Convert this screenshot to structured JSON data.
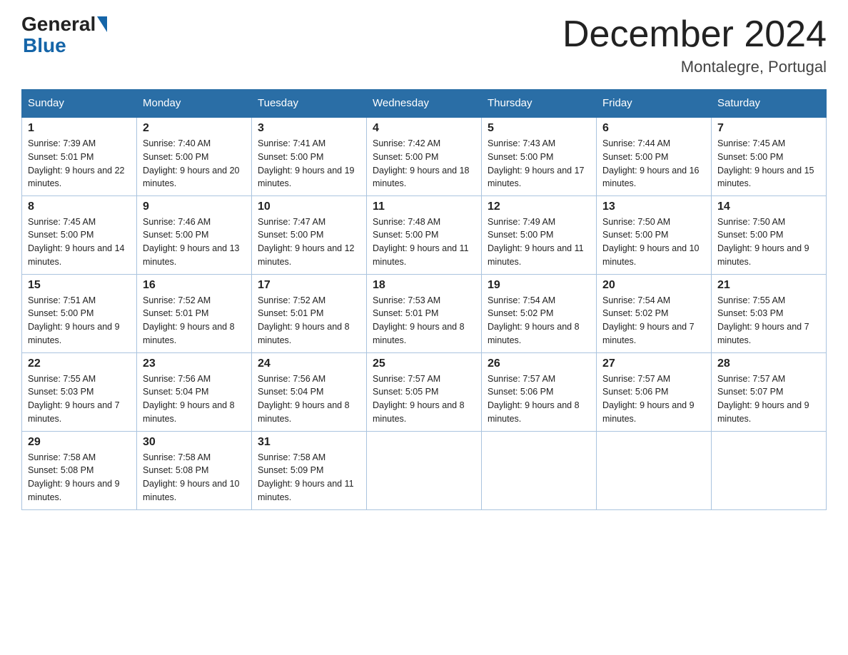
{
  "header": {
    "logo_general": "General",
    "logo_blue": "Blue",
    "month_title": "December 2024",
    "location": "Montalegre, Portugal"
  },
  "days_of_week": [
    "Sunday",
    "Monday",
    "Tuesday",
    "Wednesday",
    "Thursday",
    "Friday",
    "Saturday"
  ],
  "weeks": [
    [
      {
        "day": "1",
        "sunrise": "7:39 AM",
        "sunset": "5:01 PM",
        "daylight": "9 hours and 22 minutes."
      },
      {
        "day": "2",
        "sunrise": "7:40 AM",
        "sunset": "5:00 PM",
        "daylight": "9 hours and 20 minutes."
      },
      {
        "day": "3",
        "sunrise": "7:41 AM",
        "sunset": "5:00 PM",
        "daylight": "9 hours and 19 minutes."
      },
      {
        "day": "4",
        "sunrise": "7:42 AM",
        "sunset": "5:00 PM",
        "daylight": "9 hours and 18 minutes."
      },
      {
        "day": "5",
        "sunrise": "7:43 AM",
        "sunset": "5:00 PM",
        "daylight": "9 hours and 17 minutes."
      },
      {
        "day": "6",
        "sunrise": "7:44 AM",
        "sunset": "5:00 PM",
        "daylight": "9 hours and 16 minutes."
      },
      {
        "day": "7",
        "sunrise": "7:45 AM",
        "sunset": "5:00 PM",
        "daylight": "9 hours and 15 minutes."
      }
    ],
    [
      {
        "day": "8",
        "sunrise": "7:45 AM",
        "sunset": "5:00 PM",
        "daylight": "9 hours and 14 minutes."
      },
      {
        "day": "9",
        "sunrise": "7:46 AM",
        "sunset": "5:00 PM",
        "daylight": "9 hours and 13 minutes."
      },
      {
        "day": "10",
        "sunrise": "7:47 AM",
        "sunset": "5:00 PM",
        "daylight": "9 hours and 12 minutes."
      },
      {
        "day": "11",
        "sunrise": "7:48 AM",
        "sunset": "5:00 PM",
        "daylight": "9 hours and 11 minutes."
      },
      {
        "day": "12",
        "sunrise": "7:49 AM",
        "sunset": "5:00 PM",
        "daylight": "9 hours and 11 minutes."
      },
      {
        "day": "13",
        "sunrise": "7:50 AM",
        "sunset": "5:00 PM",
        "daylight": "9 hours and 10 minutes."
      },
      {
        "day": "14",
        "sunrise": "7:50 AM",
        "sunset": "5:00 PM",
        "daylight": "9 hours and 9 minutes."
      }
    ],
    [
      {
        "day": "15",
        "sunrise": "7:51 AM",
        "sunset": "5:00 PM",
        "daylight": "9 hours and 9 minutes."
      },
      {
        "day": "16",
        "sunrise": "7:52 AM",
        "sunset": "5:01 PM",
        "daylight": "9 hours and 8 minutes."
      },
      {
        "day": "17",
        "sunrise": "7:52 AM",
        "sunset": "5:01 PM",
        "daylight": "9 hours and 8 minutes."
      },
      {
        "day": "18",
        "sunrise": "7:53 AM",
        "sunset": "5:01 PM",
        "daylight": "9 hours and 8 minutes."
      },
      {
        "day": "19",
        "sunrise": "7:54 AM",
        "sunset": "5:02 PM",
        "daylight": "9 hours and 8 minutes."
      },
      {
        "day": "20",
        "sunrise": "7:54 AM",
        "sunset": "5:02 PM",
        "daylight": "9 hours and 7 minutes."
      },
      {
        "day": "21",
        "sunrise": "7:55 AM",
        "sunset": "5:03 PM",
        "daylight": "9 hours and 7 minutes."
      }
    ],
    [
      {
        "day": "22",
        "sunrise": "7:55 AM",
        "sunset": "5:03 PM",
        "daylight": "9 hours and 7 minutes."
      },
      {
        "day": "23",
        "sunrise": "7:56 AM",
        "sunset": "5:04 PM",
        "daylight": "9 hours and 8 minutes."
      },
      {
        "day": "24",
        "sunrise": "7:56 AM",
        "sunset": "5:04 PM",
        "daylight": "9 hours and 8 minutes."
      },
      {
        "day": "25",
        "sunrise": "7:57 AM",
        "sunset": "5:05 PM",
        "daylight": "9 hours and 8 minutes."
      },
      {
        "day": "26",
        "sunrise": "7:57 AM",
        "sunset": "5:06 PM",
        "daylight": "9 hours and 8 minutes."
      },
      {
        "day": "27",
        "sunrise": "7:57 AM",
        "sunset": "5:06 PM",
        "daylight": "9 hours and 9 minutes."
      },
      {
        "day": "28",
        "sunrise": "7:57 AM",
        "sunset": "5:07 PM",
        "daylight": "9 hours and 9 minutes."
      }
    ],
    [
      {
        "day": "29",
        "sunrise": "7:58 AM",
        "sunset": "5:08 PM",
        "daylight": "9 hours and 9 minutes."
      },
      {
        "day": "30",
        "sunrise": "7:58 AM",
        "sunset": "5:08 PM",
        "daylight": "9 hours and 10 minutes."
      },
      {
        "day": "31",
        "sunrise": "7:58 AM",
        "sunset": "5:09 PM",
        "daylight": "9 hours and 11 minutes."
      },
      null,
      null,
      null,
      null
    ]
  ]
}
